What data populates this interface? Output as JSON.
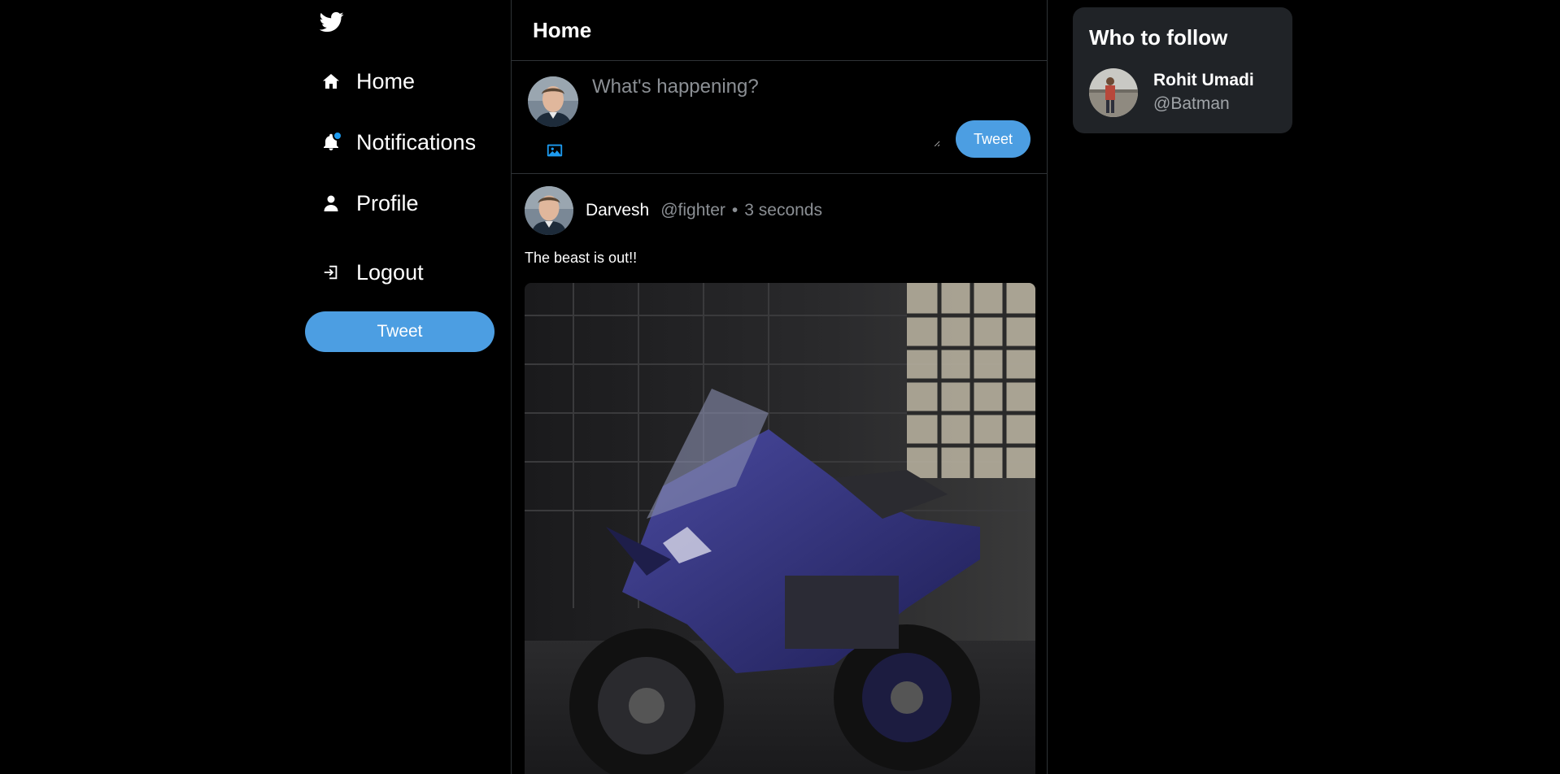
{
  "nav": {
    "items": [
      {
        "label": "Home",
        "icon": "home-icon"
      },
      {
        "label": "Notifications",
        "icon": "bell-icon"
      },
      {
        "label": "Profile",
        "icon": "user-icon"
      },
      {
        "label": "Logout",
        "icon": "logout-icon"
      }
    ],
    "tweet_label": "Tweet"
  },
  "main": {
    "title": "Home",
    "composer": {
      "placeholder": "What's happening?",
      "tweet_label": "Tweet"
    },
    "post": {
      "name": "Darvesh",
      "handle": "@fighter",
      "separator": "•",
      "time": "3 seconds",
      "text": "The beast is out!!",
      "media": "motorcycle-photo"
    }
  },
  "sidebar": {
    "title": "Who to follow",
    "user": {
      "name": "Rohit Umadi",
      "handle": "@Batman"
    }
  },
  "colors": {
    "accent": "#4c9ee2",
    "background": "#000000",
    "card": "#202327",
    "muted": "#8b8f94"
  }
}
